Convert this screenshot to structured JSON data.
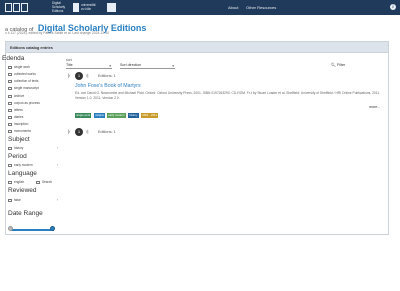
{
  "header": {
    "logo_text": [
      "Digital",
      "Scholarly",
      "Editions"
    ],
    "university": [
      "universität",
      "zu köln"
    ],
    "links": [
      "About",
      "Other Resources"
    ],
    "info_icon": "i"
  },
  "site": {
    "title_prefix": "a catalog of",
    "title_main": "Digital Scholarly Editions",
    "version": "v 4.117 (2024), edited by Patrick Sahle et al. Last change 2024-12-10"
  },
  "panel": {
    "title": "Editions catalog entries"
  },
  "sidebar": {
    "sections": [
      {
        "heading": "Edenda",
        "items": [
          {
            "label": "single work"
          },
          {
            "label": "collected works"
          },
          {
            "label": "collection of texts"
          },
          {
            "label": "single manuscript"
          },
          {
            "label": "archive"
          },
          {
            "label": "corpus as process"
          },
          {
            "label": "letters"
          },
          {
            "label": "diaries"
          },
          {
            "label": "inscription"
          },
          {
            "label": "monumenta"
          }
        ]
      },
      {
        "heading": "Subject",
        "items": [
          {
            "label": "history",
            "more": "›"
          }
        ]
      },
      {
        "heading": "Period",
        "items": [
          {
            "label": "early modern",
            "more": "›"
          }
        ]
      },
      {
        "heading": "Language",
        "items": [
          {
            "label": "english",
            "label2": "Search"
          }
        ]
      },
      {
        "heading": "Reviewed",
        "items": [
          {
            "label": "false",
            "more": "›"
          }
        ]
      },
      {
        "heading": "Date Range",
        "items": []
      }
    ],
    "date_range": {
      "min_handle": 0,
      "max_handle": 1
    }
  },
  "results": {
    "sort_label": "sort",
    "sort_value": "Title",
    "direction_value": "Sort direction",
    "filter_label": "Filter",
    "pager_top": {
      "page": "1",
      "prev": "|‹",
      "next": "›|",
      "count": "Editions: 1"
    },
    "pager_bottom": {
      "page": "1",
      "prev": "|‹",
      "next": "›|",
      "count": "Editions: 1"
    },
    "item": {
      "title": "John Foxe's Book of Martyrs",
      "description": "Ed. von David G. Newcombe and Michael Pidd. Oxford: Oxford University Press, 2001. ISBN 0197263290. CD-ROM. Fr-t by Stuart Loader et al. Sheffield: University of Sheffield / HRI Online Publications, 2011. Version 1.0, 2011. Version 2.0.",
      "more_label": "more..."
    },
    "tags": [
      {
        "label": "single work",
        "color": "#3a8a5c"
      },
      {
        "label": "religion",
        "color": "#2a7fc1"
      },
      {
        "label": "early modern",
        "color": "#5aa05a"
      },
      {
        "label": "history",
        "color": "#1f5f9a"
      },
      {
        "label": "2001 · 2011",
        "color": "#c89a2a"
      }
    ]
  }
}
